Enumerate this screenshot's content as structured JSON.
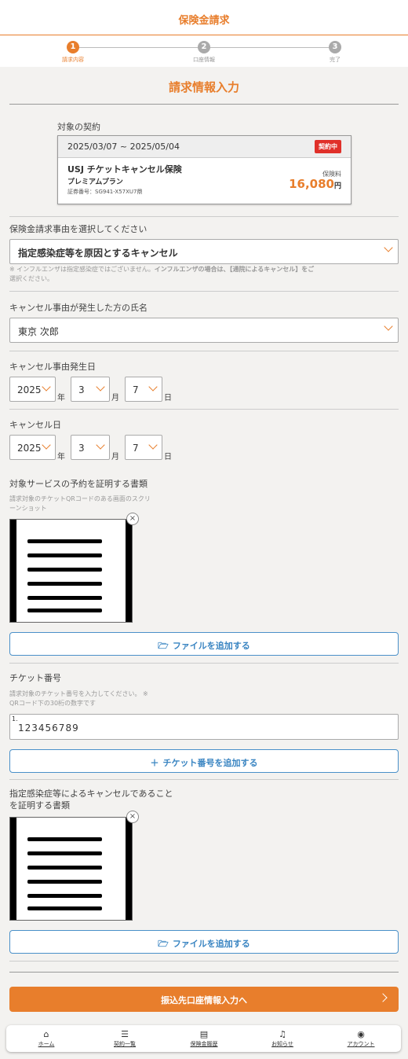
{
  "header": {
    "title": "保険金請求"
  },
  "steps": [
    {
      "num": "1",
      "label": "請求内容"
    },
    {
      "num": "2",
      "label": "口座情報"
    },
    {
      "num": "3",
      "label": "完了"
    }
  ],
  "section_title": "請求情報入力",
  "contract": {
    "label": "対象の契約",
    "period": "2025/03/07 ~ 2025/05/04",
    "status": "契約中",
    "name": "USJ チケットキャンセル保険",
    "plan": "プレミアムプラン",
    "cert_no": "証券番号：SG941-X57XU7鼎",
    "premium_label": "保険料",
    "premium_value": "16,080",
    "premium_unit": "円"
  },
  "reason": {
    "label": "保険金請求事由を選択してください",
    "value": "指定感染症等を原因とするキャンセル",
    "note_a": "※ インフルエンザは指定感染症ではございません。",
    "note_b": "インフルエンザの場合は、【通院によるキャンセル】をご",
    "note_c": "選択ください。"
  },
  "person": {
    "label": "キャンセル事由が発生した方の氏名",
    "value": "東京 次郎"
  },
  "occur_date": {
    "label": "キャンセル事由発生日",
    "year": "2025",
    "month": "3",
    "day": "7",
    "year_unit": "年",
    "month_unit": "月",
    "day_unit": "日"
  },
  "cancel_date": {
    "label": "キャンセル日",
    "year": "2025",
    "month": "3",
    "day": "7",
    "year_unit": "年",
    "month_unit": "月",
    "day_unit": "日"
  },
  "reservation_doc": {
    "label": "対象サービスの予約を証明する書類",
    "note_a": "請求対象のチケットQRコードのある画面のスクリ",
    "note_b": "ーンショット",
    "remove": "×",
    "add_label": "ファイルを追加する"
  },
  "ticket": {
    "label": "チケット番号",
    "note_a": "請求対象のチケット番号を入力してください。 ※",
    "note_b": "QRコード下の30桁の数字です",
    "index": "1.",
    "value": "123456789",
    "add_label": "チケット番号を追加する"
  },
  "infection_doc": {
    "label_a": "指定感染症等によるキャンセルであること",
    "label_b": "を証明する書類",
    "remove": "×",
    "add_label": "ファイルを追加する"
  },
  "next_button": "振込先口座情報入力へ",
  "tabs": [
    {
      "icon": "home-icon",
      "glyph": "⌂",
      "label": "ホーム"
    },
    {
      "icon": "list-icon",
      "glyph": "☰",
      "label": "契約一覧"
    },
    {
      "icon": "document-history-icon",
      "glyph": "▤",
      "label": "保険金履歴"
    },
    {
      "icon": "bell-icon",
      "glyph": "♫",
      "label": "お知らせ"
    },
    {
      "icon": "account-icon",
      "glyph": "◉",
      "label": "アカウント"
    }
  ],
  "colors": {
    "accent": "#e87e2c",
    "badge": "#e0302a",
    "link": "#3a85c2"
  }
}
